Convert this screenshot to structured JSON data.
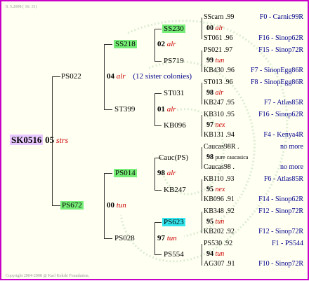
{
  "header": {
    "date": "8. 5.2008 ( 16: 31)"
  },
  "footer": {
    "copyright": "Copyright 2004-2008 @ Karl Kehrle Foundation."
  },
  "subject": {
    "id": "SK0516",
    "gen": "05",
    "tag": "strs"
  },
  "father": {
    "id": "PS022",
    "gen": "04",
    "tag": "alr",
    "note": "(12 sister colonies)"
  },
  "mother": {
    "id": "PS672",
    "gen": "00",
    "tag": "tun"
  },
  "ff": {
    "id": "SS218",
    "gen": "02",
    "tag": "alr"
  },
  "fm": {
    "id": "ST399",
    "gen": "01",
    "tag": "alr"
  },
  "mf": {
    "id": "PS014",
    "gen": "98",
    "tag": "alr"
  },
  "mm": {
    "id": "PS028",
    "gen": "97",
    "tag": "tun"
  },
  "fff": {
    "id": "SS230",
    "gen": "00",
    "tag": "alr"
  },
  "ffm": {
    "id": "PS719",
    "gen": "99",
    "tag": "tun"
  },
  "fmf": {
    "id": "ST031",
    "gen": "98",
    "tag": "alr"
  },
  "fmm": {
    "id": "KB096",
    "gen": "97",
    "tag": "nex"
  },
  "mff": {
    "id": "Cauc(PS)",
    "gen": "98",
    "tag": "pure caucasica"
  },
  "mfm": {
    "id": "KB247",
    "gen": "95",
    "tag": "nex"
  },
  "mmf": {
    "id": "PS623",
    "gen": "95",
    "tag": "tun"
  },
  "mmm": {
    "id": "PS554",
    "gen": "94",
    "tag": "tun"
  },
  "leaves": [
    {
      "name": "SScarn .99",
      "fam": "F0 - Carnic99R"
    },
    {
      "name": "ST061 .96",
      "fam": "F16 - Sinop62R"
    },
    {
      "name": "PS021 .97",
      "fam": "F15 - Sinop72R"
    },
    {
      "name": "KB430 .96",
      "fam": "F7 - SinopEgg86R"
    },
    {
      "name": "ST013 .96",
      "fam": "F8 - SinopEgg86R"
    },
    {
      "name": "KB247 .95",
      "fam": "F7 - Atlas85R"
    },
    {
      "name": "KB310 .95",
      "fam": "F16 - Sinop62R"
    },
    {
      "name": "KB131 .94",
      "fam": "F4 - Kenya4R"
    },
    {
      "name": "Caucas98R .",
      "fam": "no more"
    },
    {
      "name": "Caucas98 .",
      "fam": "no more"
    },
    {
      "name": "KB110 .93",
      "fam": "F6 - Atlas85R"
    },
    {
      "name": "KB096 .91",
      "fam": "F14 - Sinop62R"
    },
    {
      "name": "KB348 .92",
      "fam": "F12 - Sinop72R"
    },
    {
      "name": "KB202 .92",
      "fam": "F12 - Sinop72R"
    },
    {
      "name": "PS530 .92",
      "fam": "F1 - PS544"
    },
    {
      "name": "AG307 .91",
      "fam": "F10 - Sinop72R"
    }
  ]
}
